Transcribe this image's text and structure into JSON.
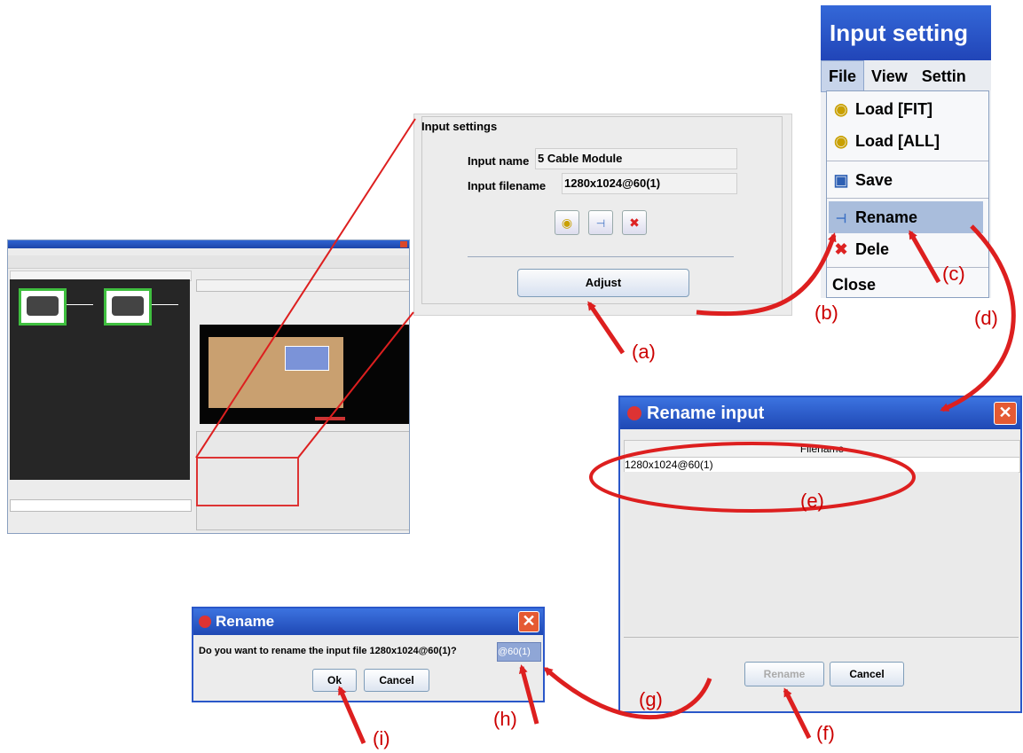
{
  "input_settings": {
    "title": "Input settings",
    "name_label": "Input name",
    "name_value": "5 Cable Module",
    "filename_label": "Input filename",
    "filename_value": "1280x1024@60(1)",
    "adjust_label": "Adjust"
  },
  "menu_panel": {
    "title": "Input setting",
    "menubar": [
      "File",
      "View",
      "Settin"
    ],
    "items": [
      "Load [FIT]",
      "Load [ALL]",
      "Save",
      "Rename",
      "Dele",
      "Close"
    ]
  },
  "rename_input_dialog": {
    "title": "Rename input",
    "column_header": "Filename",
    "row_value": "1280x1024@60(1)",
    "rename_button": "Rename",
    "cancel_button": "Cancel"
  },
  "rename_confirm_dialog": {
    "title": "Rename",
    "message": "Do you want to rename the input file 1280x1024@60(1)?",
    "field_value": "@60(1)",
    "ok_button": "Ok",
    "cancel_button": "Cancel"
  },
  "annotations": [
    "(a)",
    "(b)",
    "(c)",
    "(d)",
    "(e)",
    "(f)",
    "(g)",
    "(h)",
    "(i)"
  ],
  "colors": {
    "annotation": "#dd1f1f",
    "titlebar": "#2a57c9"
  }
}
